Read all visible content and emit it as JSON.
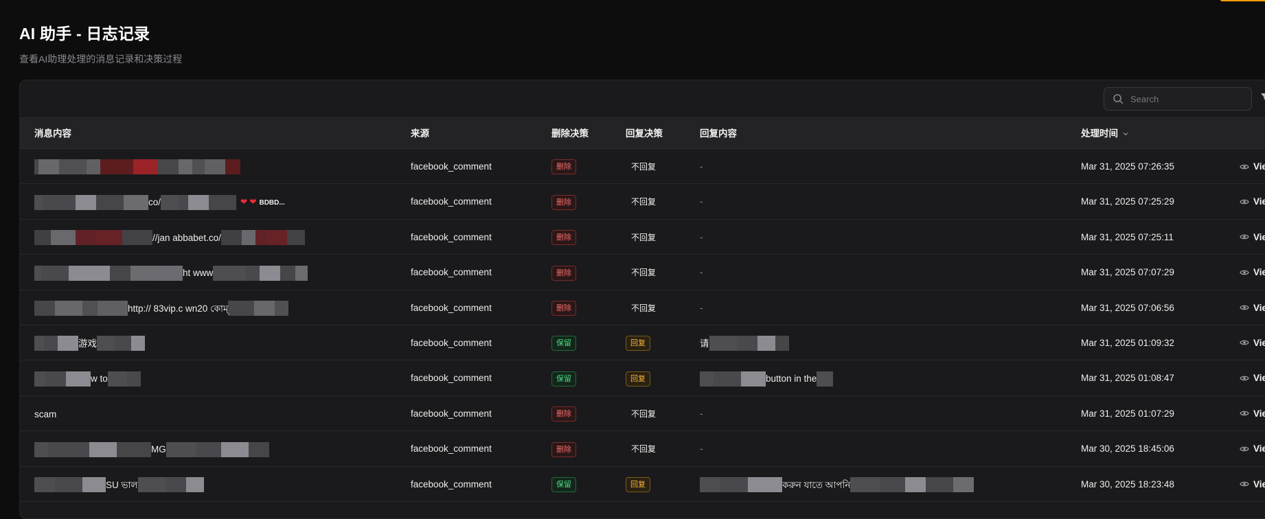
{
  "accent_color": "#f59e0b",
  "header": {
    "title": "AI 助手 - 日志记录",
    "subtitle": "查看AI助理处理的消息记录和决策过程"
  },
  "search": {
    "placeholder": "Search"
  },
  "columns": {
    "message": "消息内容",
    "source": "来源",
    "delete_decision": "删除决策",
    "reply_decision": "回复决策",
    "reply_content": "回复内容",
    "time": "处理时间"
  },
  "labels": {
    "delete": "删除",
    "keep": "保留",
    "reply": "回复",
    "no_reply": "不回复",
    "view": "View"
  },
  "rows": [
    {
      "message_visible": "",
      "source": "facebook_comment",
      "delete_decision": "删除",
      "reply_decision": "不回复",
      "reply_content": "-",
      "time": "Mar 31, 2025 07:26:35"
    },
    {
      "message_visible": "co/",
      "suffix": "BDBD...",
      "source": "facebook_comment",
      "delete_decision": "删除",
      "reply_decision": "不回复",
      "reply_content": "-",
      "time": "Mar 31, 2025 07:25:29"
    },
    {
      "message_visible": "//jan   abbabet.co/",
      "source": "facebook_comment",
      "delete_decision": "删除",
      "reply_decision": "不回复",
      "reply_content": "-",
      "time": "Mar 31, 2025 07:25:11"
    },
    {
      "message_visible": "ht   www",
      "source": "facebook_comment",
      "delete_decision": "删除",
      "reply_decision": "不回复",
      "reply_content": "-",
      "time": "Mar 31, 2025 07:07:29"
    },
    {
      "message_visible": "http://   83vip.c   wn20   কোম্",
      "source": "facebook_comment",
      "delete_decision": "删除",
      "reply_decision": "不回复",
      "reply_content": "-",
      "time": "Mar 31, 2025 07:06:56"
    },
    {
      "message_visible": "游戏",
      "source": "facebook_comment",
      "delete_decision": "保留",
      "reply_decision": "回复",
      "reply_content": "请",
      "time": "Mar 31, 2025 01:09:32"
    },
    {
      "message_visible": "w to",
      "source": "facebook_comment",
      "delete_decision": "保留",
      "reply_decision": "回复",
      "reply_content": "button in the",
      "time": "Mar 31, 2025 01:08:47"
    },
    {
      "message_visible": "scam",
      "source": "facebook_comment",
      "delete_decision": "删除",
      "reply_decision": "不回复",
      "reply_content": "-",
      "time": "Mar 31, 2025 01:07:29"
    },
    {
      "message_visible": "MG",
      "source": "facebook_comment",
      "delete_decision": "删除",
      "reply_decision": "不回复",
      "reply_content": "-",
      "time": "Mar 30, 2025 18:45:06"
    },
    {
      "message_visible": "SU   ভাল",
      "source": "facebook_comment",
      "delete_decision": "保留",
      "reply_decision": "回复",
      "reply_content": "করুন যাতে আপনি",
      "time": "Mar 30, 2025 18:23:48"
    }
  ]
}
